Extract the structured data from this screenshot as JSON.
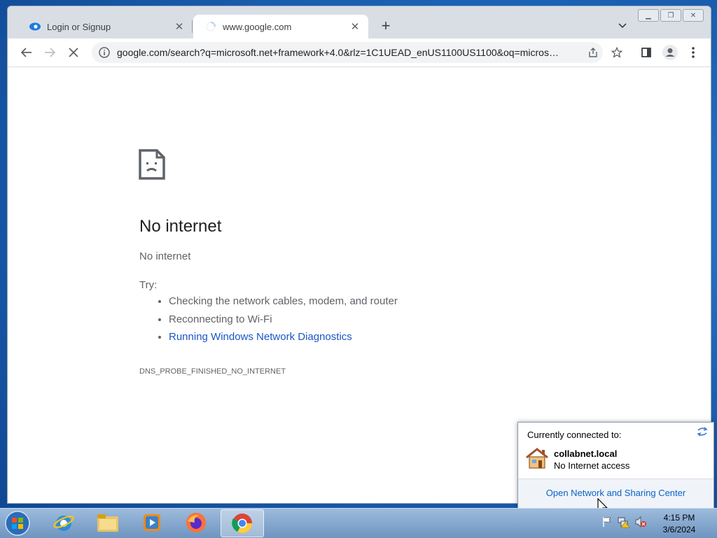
{
  "tabs": [
    {
      "label": "Login or Signup",
      "icon": "blue-swirl-icon"
    },
    {
      "label": "www.google.com",
      "icon": "loading-spinner-icon"
    }
  ],
  "toolbar": {
    "url": "google.com/search?q=microsoft.net+framework+4.0&rlz=1C1UEAD_enUS1100US1100&oq=micros…"
  },
  "error": {
    "title": "No internet",
    "subtitle": "No internet",
    "try_label": "Try:",
    "tips": [
      "Checking the network cables, modem, and router",
      "Reconnecting to Wi-Fi",
      "Running Windows Network Diagnostics"
    ],
    "code": "DNS_PROBE_FINISHED_NO_INTERNET"
  },
  "network_popup": {
    "header": "Currently connected to:",
    "network_name": "collabnet.local",
    "status": "No Internet access",
    "link": "Open Network and Sharing Center"
  },
  "taskbar": {
    "apps": [
      "internet-explorer",
      "windows-explorer",
      "media-player",
      "firefox",
      "chrome"
    ],
    "time": "4:15 PM",
    "date": "3/6/2024"
  },
  "colors": {
    "link": "#1a56c6",
    "desktop": "#1d5fb0"
  }
}
